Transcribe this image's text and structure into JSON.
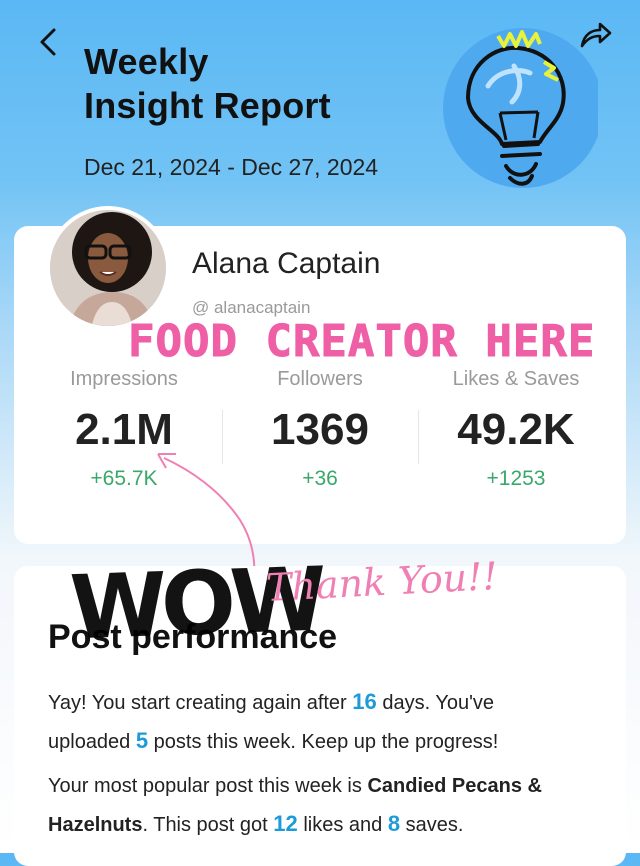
{
  "header": {
    "title_line1": "Weekly",
    "title_line2": "Insight Report",
    "date_range": "Dec 21, 2024 - Dec 27, 2024"
  },
  "profile": {
    "name": "Alana Captain",
    "handle": "@ alanacaptain"
  },
  "overlays": {
    "food_creator": "FOOD CREATOR HERE",
    "wow": "WOW",
    "thank_you": "Thank You!!"
  },
  "stats": [
    {
      "label": "Impressions",
      "value": "2.1M",
      "delta": "+65.7K"
    },
    {
      "label": "Followers",
      "value": "1369",
      "delta": "+36"
    },
    {
      "label": "Likes & Saves",
      "value": "49.2K",
      "delta": "+1253"
    }
  ],
  "post_performance": {
    "title": "Post performance",
    "p1_a": "Yay! You start creating again after ",
    "p1_days": "16",
    "p1_b": " days. You've",
    "p1_c": "uploaded ",
    "p1_posts": "5",
    "p1_d": " posts this week. Keep up the progress!",
    "p2_a": "Your most popular post this week is ",
    "p2_post1": "Candied Pecans &",
    "p2_post2": "Hazelnuts",
    "p2_b": ". This post got ",
    "p2_likes": "12",
    "p2_c": " likes and ",
    "p2_saves": "8",
    "p2_d": " saves."
  },
  "colors": {
    "accent_blue": "#1d9bd8",
    "positive_green": "#3aa86b",
    "overlay_pink": "#ef5fa6"
  },
  "icons": {
    "back": "chevron-left-icon",
    "share": "share-icon",
    "bulb": "lightbulb-icon"
  }
}
